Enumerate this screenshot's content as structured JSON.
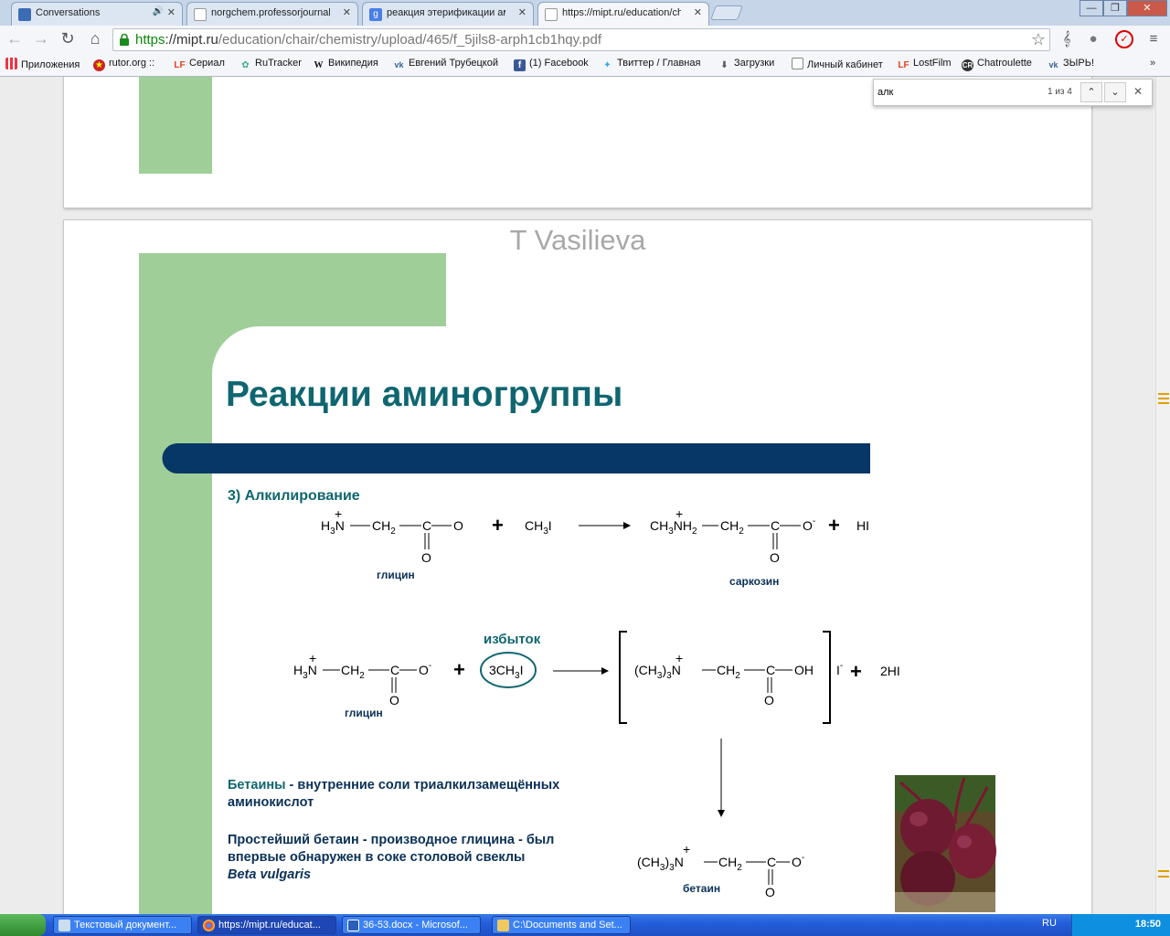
{
  "tabs": [
    {
      "label": "Conversations",
      "active": false,
      "has_sound": true
    },
    {
      "label": "norgchem.professorjournal.r",
      "active": false,
      "has_sound": false
    },
    {
      "label": "реакция этерификации ами",
      "active": false,
      "has_sound": false
    },
    {
      "label": "https://mipt.ru/education/ch",
      "active": true,
      "has_sound": false
    }
  ],
  "omnibox": {
    "scheme": "https",
    "host": "://mipt.ru",
    "path": "/education/chair/chemistry/upload/465/f_5jils8-arph1cb1hqy.pdf"
  },
  "bookmarks": [
    {
      "label": "Приложения",
      "icon": "apps-grid-icon"
    },
    {
      "label": "rutor.org ::",
      "icon": "rutor-icon"
    },
    {
      "label": "Сериал",
      "icon": "lostfilm-icon"
    },
    {
      "label": "RuTracker",
      "icon": "rutracker-icon"
    },
    {
      "label": "Википедия",
      "icon": "wikipedia-icon"
    },
    {
      "label": "Евгений Трубецкой",
      "icon": "vk-icon"
    },
    {
      "label": "(1) Facebook",
      "icon": "facebook-icon"
    },
    {
      "label": "Твиттер / Главная",
      "icon": "twitter-icon"
    },
    {
      "label": "Загрузки",
      "icon": "download-icon"
    },
    {
      "label": "Личный кабинет",
      "icon": "page-icon"
    },
    {
      "label": "LostFilm",
      "icon": "lostfilm-icon"
    },
    {
      "label": "Chatroulette",
      "icon": "chatroulette-icon"
    },
    {
      "label": "ЗЫРЬ!",
      "icon": "vk-icon"
    }
  ],
  "find": {
    "query": "алк",
    "count": "1 из 4"
  },
  "slide": {
    "author": "T Vasilieva",
    "title": "Реакции аминогруппы",
    "section": "3) Алкилирование",
    "reaction1": {
      "glycine_formula": [
        "H",
        "3",
        "N",
        "CH",
        "2",
        "C",
        "O",
        "O"
      ],
      "plus": "+",
      "reagent": "CH3I",
      "product": "CH3NH2",
      "byproduct": "HI",
      "label_left": "глицин",
      "label_right": "саркозин"
    },
    "reaction2": {
      "excess": "избыток",
      "reagent": "3CH3I",
      "product_head": "(CH3)3N",
      "counter_ion": "I",
      "byproduct": "2HI",
      "label_left": "глицин",
      "betaine_label": "бетаин"
    },
    "text1_bold": "Бетаины",
    "text1_rest": " - внутренние соли триалкилзамещённых аминокислот",
    "text2": "Простейший бетаин - производное глицина - был впервые обнаружен в соке столовой свеклы",
    "text2_italic": "Beta vulgaris"
  },
  "taskbar": {
    "items": [
      {
        "label": "Текстовый документ...",
        "active": false
      },
      {
        "label": "https://mipt.ru/educat...",
        "active": true
      },
      {
        "label": "36-53.docx - Microsof...",
        "active": false
      },
      {
        "label": "C:\\Documents and Set...",
        "active": false
      }
    ],
    "lang": "RU",
    "clock": "18:50"
  }
}
